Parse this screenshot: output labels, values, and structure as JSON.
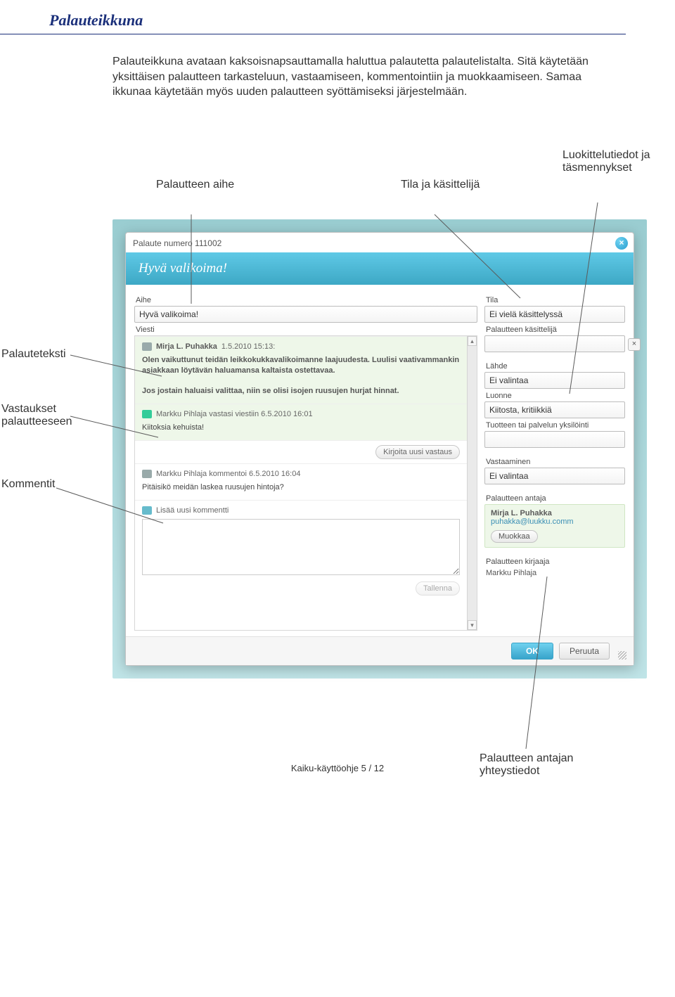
{
  "page": {
    "title": "Palauteikkuna",
    "intro": "Palauteikkuna avataan kaksoisnapsauttamalla haluttua palautetta palautelistalta. Sitä käytetään yksittäisen palautteen tarkasteluun, vastaamiseen, kommentointiin ja muokkaamiseen. Samaa ikkunaa käytetään myös uuden palautteen syöttämiseksi järjestelmään.",
    "footer": "Kaiku-käyttöohje  5 / 12"
  },
  "annotations": {
    "aihe": "Palautteen aihe",
    "tila": "Tila ja käsittelijä",
    "luokittelu": "Luokittelutiedot ja täsmennykset",
    "palauteteksti": "Palauteteksti",
    "vastaukset_l1": "Vastaukset",
    "vastaukset_l2": "palautteeseen",
    "kommentit": "Kommentit",
    "antaja_l1": "Palautteen antajan",
    "antaja_l2": "yhteystiedot"
  },
  "dialog": {
    "window_title": "Palaute numero 111002",
    "hero": "Hyvä valikoima!",
    "left": {
      "aihe_label": "Aihe",
      "aihe_value": "Hyvä valikoima!",
      "viesti_label": "Viesti",
      "msg1_head_author": "Mirja L. Puhakka",
      "msg1_head_time": "1.5.2010 15:13:",
      "msg1_body_p1": "Olen vaikuttunut teidän leikkokukkavalikoimanne laajuudesta. Luulisi vaativammankin asiakkaan löytävän haluamansa kaltaista ostettavaa.",
      "msg1_body_p2": "Jos jostain haluaisi valittaa, niin se olisi isojen ruusujen hurjat hinnat.",
      "reply_head": "Markku Pihlaja vastasi viestiin 6.5.2010 16:01",
      "reply_body": "Kiitoksia kehuista!",
      "write_reply_btn": "Kirjoita uusi vastaus",
      "comment_head": "Markku Pihlaja kommentoi 6.5.2010 16:04",
      "comment_body": "Pitäisikö meidän laskea ruusujen hintoja?",
      "add_comment_head": "Lisää uusi kommentti",
      "save_btn": "Tallenna"
    },
    "right": {
      "tila_label": "Tila",
      "tila_value": "Ei vielä käsittelyssä",
      "kasittelija_label": "Palautteen käsittelijä",
      "kasittelija_value": "",
      "lahde_label": "Lähde",
      "lahde_value": "Ei valintaa",
      "luonne_label": "Luonne",
      "luonne_value": "Kiitosta, kritiikkiä",
      "yksil_label": "Tuotteen tai palvelun yksilöinti",
      "yksil_value": "",
      "vastaaminen_label": "Vastaaminen",
      "vastaaminen_value": "Ei valintaa",
      "antaja_label": "Palautteen antaja",
      "antaja_name": "Mirja L. Puhakka",
      "antaja_email": "puhakka@luukku.comm",
      "muokkaa_btn": "Muokkaa",
      "kirjaaja_label": "Palautteen kirjaaja",
      "kirjaaja_value": "Markku Pihlaja"
    },
    "ok": "OK",
    "cancel": "Peruuta"
  }
}
